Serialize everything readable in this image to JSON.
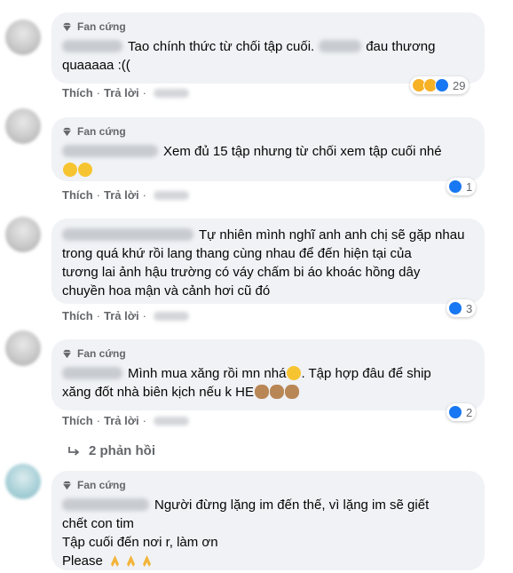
{
  "badge_label": "Fan cứng",
  "action_like": "Thích",
  "action_reply": "Trả lời",
  "dot": "·",
  "colors": {
    "link_blue": "#1877f2",
    "bubble_bg": "#f0f2f5",
    "meta_gray": "#65676b"
  },
  "comments": [
    {
      "line1": "Tao chính thức từ chối tập cuối.",
      "line1b": "đau thương",
      "line2": "quaaaaa :((",
      "reaction_count": "29",
      "reaction_icons": [
        "haha-icon",
        "sad-icon",
        "like-icon"
      ]
    },
    {
      "line1": "Xem đủ 15 tập nhưng từ chối xem tập cuối nhé",
      "reaction_count": "1",
      "reaction_icons": [
        "like-icon"
      ]
    },
    {
      "line1": "Tự nhiên mình nghĩ anh anh chị sẽ gặp nhau",
      "line2": "trong quá khứ rồi lang thang cùng nhau để đến hiện tại của",
      "line3": "tương lai ảnh hậu trường có váy chấm bi áo khoác hồng dây",
      "line4": "chuyền hoa mận và cảnh hơi cũ đó",
      "reaction_count": "3",
      "reaction_icons": [
        "like-icon"
      ]
    },
    {
      "line1": "Mình mua xăng rồi mn nhá",
      "line1b": ". Tập hợp đâu để ship",
      "line2": "xăng đốt nhà biên kịch nếu k HE",
      "reaction_count": "2",
      "reaction_icons": [
        "like-icon"
      ],
      "replies_label": "2 phản hồi"
    },
    {
      "line1": "Người đừng lặng im đến thế, vì lặng im sẽ giết",
      "line2": "chết con tim",
      "line3": "Tập cuối đến nơi r, làm ơn",
      "line4": "Please"
    }
  ]
}
